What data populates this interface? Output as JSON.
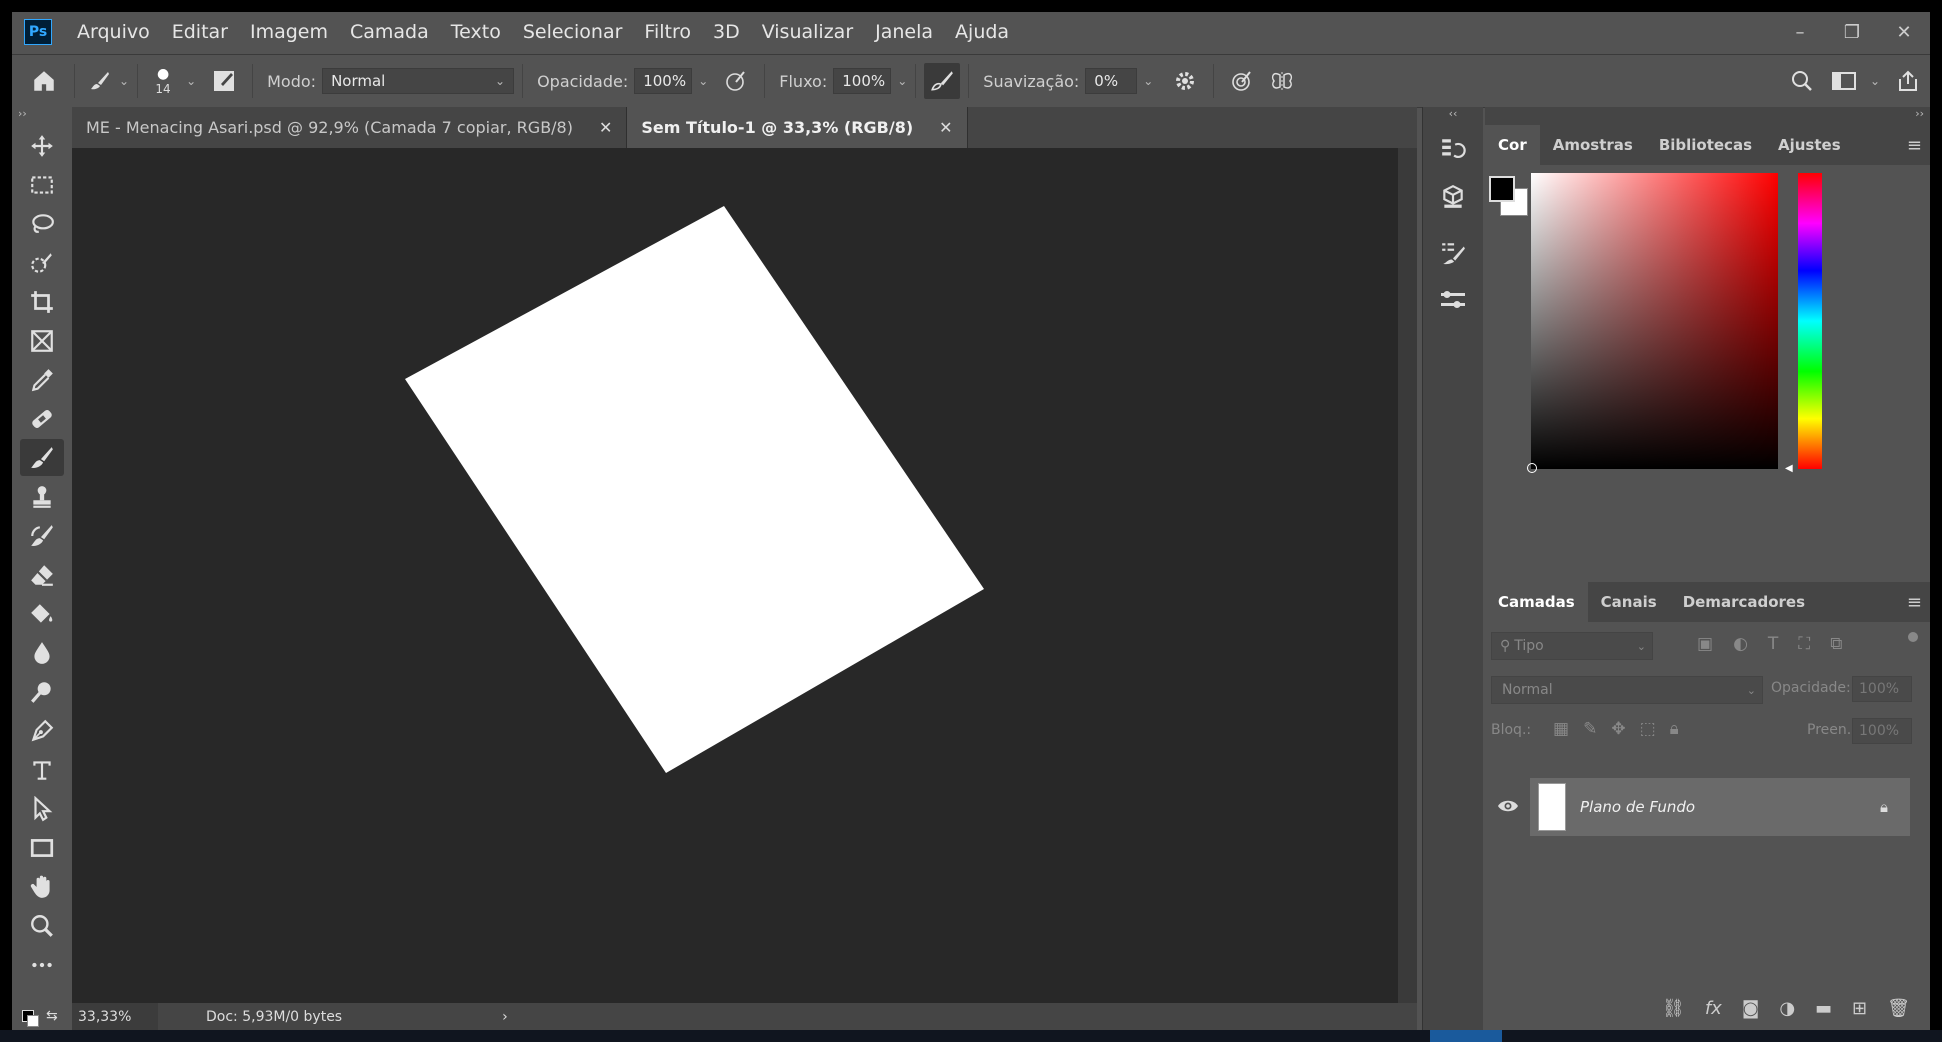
{
  "app": {
    "logo": "Ps",
    "menu": [
      "Arquivo",
      "Editar",
      "Imagem",
      "Camada",
      "Texto",
      "Selecionar",
      "Filtro",
      "3D",
      "Visualizar",
      "Janela",
      "Ajuda"
    ],
    "window_controls": {
      "minimize": "–",
      "restore": "❐",
      "close": "✕"
    }
  },
  "options": {
    "brush_size": "14",
    "mode_label": "Modo:",
    "mode_value": "Normal",
    "opacity_label": "Opacidade:",
    "opacity_value": "100%",
    "flow_label": "Fluxo:",
    "flow_value": "100%",
    "smoothing_label": "Suavização:",
    "smoothing_value": "0%"
  },
  "tabs": [
    {
      "label": "ME - Menacing Asari.psd @ 92,9% (Camada 7 copiar, RGB/8)",
      "close": "✕"
    },
    {
      "label": "Sem Título-1 @ 33,3% (RGB/8)",
      "close": "✕"
    }
  ],
  "status": {
    "zoom": "33,33%",
    "doc": "Doc: 5,93M/0 bytes",
    "arrow": "›"
  },
  "color_panel": {
    "tabs": [
      "Cor",
      "Amostras",
      "Bibliotecas",
      "Ajustes"
    ],
    "foreground": "#000000",
    "background": "#ffffff",
    "hue": "#ff0000"
  },
  "layers_panel": {
    "tabs": [
      "Camadas",
      "Canais",
      "Demarcadores"
    ],
    "filter_placeholder": "Tipo",
    "blend_mode": "Normal",
    "opacity_label": "Opacidade:",
    "opacity_value": "100%",
    "lock_label": "Bloq.:",
    "fill_label": "Preen.:",
    "fill_value": "100%",
    "layers": [
      {
        "name": "Plano de Fundo",
        "visible": true,
        "locked": true
      }
    ]
  },
  "collapse": {
    "left": "››",
    "mid": "‹‹",
    "right": "››"
  }
}
